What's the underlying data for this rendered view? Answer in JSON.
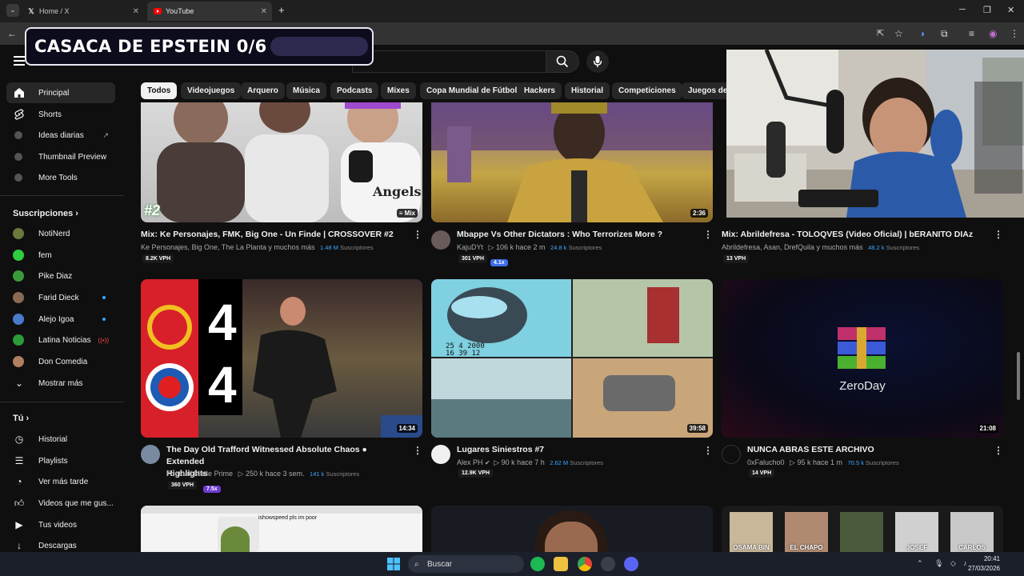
{
  "browser": {
    "tabs": [
      {
        "label": "Home / X"
      },
      {
        "label": "YouTube"
      }
    ],
    "new_tab": "+"
  },
  "overlay": {
    "title": "CASACA DE EPSTEIN 0/6"
  },
  "sidebar": {
    "main": [
      {
        "label": "Principal"
      },
      {
        "label": "Shorts"
      },
      {
        "label": "Ideas diarias"
      },
      {
        "label": "Thumbnail Preview"
      },
      {
        "label": "More Tools"
      }
    ],
    "subs_heading": "Suscripciones",
    "subs": [
      {
        "label": "NotiNerd",
        "color": "#6b7a3a"
      },
      {
        "label": "fem",
        "color": "#2ecc40"
      },
      {
        "label": "Pike Diaz",
        "color": "#3a9a3a"
      },
      {
        "label": "Farid Dieck",
        "color": "#8a6a52"
      },
      {
        "label": "Alejo Igoa",
        "color": "#4a7acc"
      },
      {
        "label": "Latina Noticias",
        "color": "#2a9a3a"
      },
      {
        "label": "Don Comedia",
        "color": "#b08060"
      },
      {
        "label": "Mostrar más"
      }
    ],
    "you_heading": "Tú",
    "you": [
      {
        "label": "Historial"
      },
      {
        "label": "Playlists"
      },
      {
        "label": "Ver más tarde"
      },
      {
        "label": "Videos que me gus..."
      },
      {
        "label": "Tus videos"
      },
      {
        "label": "Descargas"
      }
    ]
  },
  "chips": [
    "Todos",
    "Videojuegos",
    "Arquero",
    "Música",
    "Podcasts",
    "Mixes",
    "Copa Mundial de Fútbol",
    "Hackers",
    "Historial",
    "Competiciones",
    "Juegos de a"
  ],
  "videos": [
    {
      "title": "Mix: Ke Personajes, FMK, Big One - Un Finde | CROSSOVER #2",
      "channel": "Ke Personajes, Big One, The La Planta y muchos más",
      "subs": "1.48 M",
      "subs_label": "Suscriptores",
      "vph": "8.2K VPH",
      "badge": "Mix",
      "tag": "#2"
    },
    {
      "title": "Mbappe Vs Other Dictators : Who Terrorizes More ?",
      "channel": "KajuDYt",
      "stats": "▷ 106 k   hace 2 m",
      "subs": "24.8 k",
      "subs_label": "Suscriptores",
      "vph": "301 VPH",
      "mult": "4.1x",
      "duration": "2:36"
    },
    {
      "title": "Mix: Abrildefresa - TOLOQVES (Video Oficial) | bERANITO DIAz",
      "channel": "Abrildefresa, Asan, DrefQuila y muchos más",
      "subs": "48.2 k",
      "subs_label": "Suscriptores",
      "vph": "13 VPH"
    },
    {
      "title_line1": "The Day Old Trafford Witnessed Absolute Chaos ● Extended",
      "title_line2": "Highlights",
      "channel": "Football Made Prime",
      "stats": "▷ 250 k   hace 3 sem.",
      "subs": "141 k",
      "subs_label": "Suscriptores",
      "vph": "360 VPH",
      "mult": "7.5x",
      "duration": "14:34",
      "score_top": "4",
      "score_bottom": "4"
    },
    {
      "title": "Lugares Siniestros #7",
      "channel": "Alex PH",
      "stats": "▷ 90 k   hace 7 h",
      "subs": "2.62 M",
      "subs_label": "Suscriptores",
      "vph": "12.9K VPH",
      "duration": "39:58",
      "stamp": "25 4 2000\n16 39 12"
    },
    {
      "title": "NUNCA ABRAS ESTE ARCHIVO",
      "channel": "0xFalucho0",
      "stats": "▷ 95 k   hace 1 m",
      "subs": "70.5 k",
      "subs_label": "Suscriptores",
      "vph": "14 VPH",
      "duration": "21:08",
      "thumb_text": "ZeroDay"
    }
  ],
  "bottom_thumb_labels": [
    "OSAMA BIN",
    "EL CHAPO",
    "JOSEF",
    "CARLOS"
  ],
  "bottom_thumb_text": "ishowspeed pls im poor",
  "taskbar": {
    "search": "Buscar",
    "time": "20:41",
    "date": "27/03/2026"
  }
}
